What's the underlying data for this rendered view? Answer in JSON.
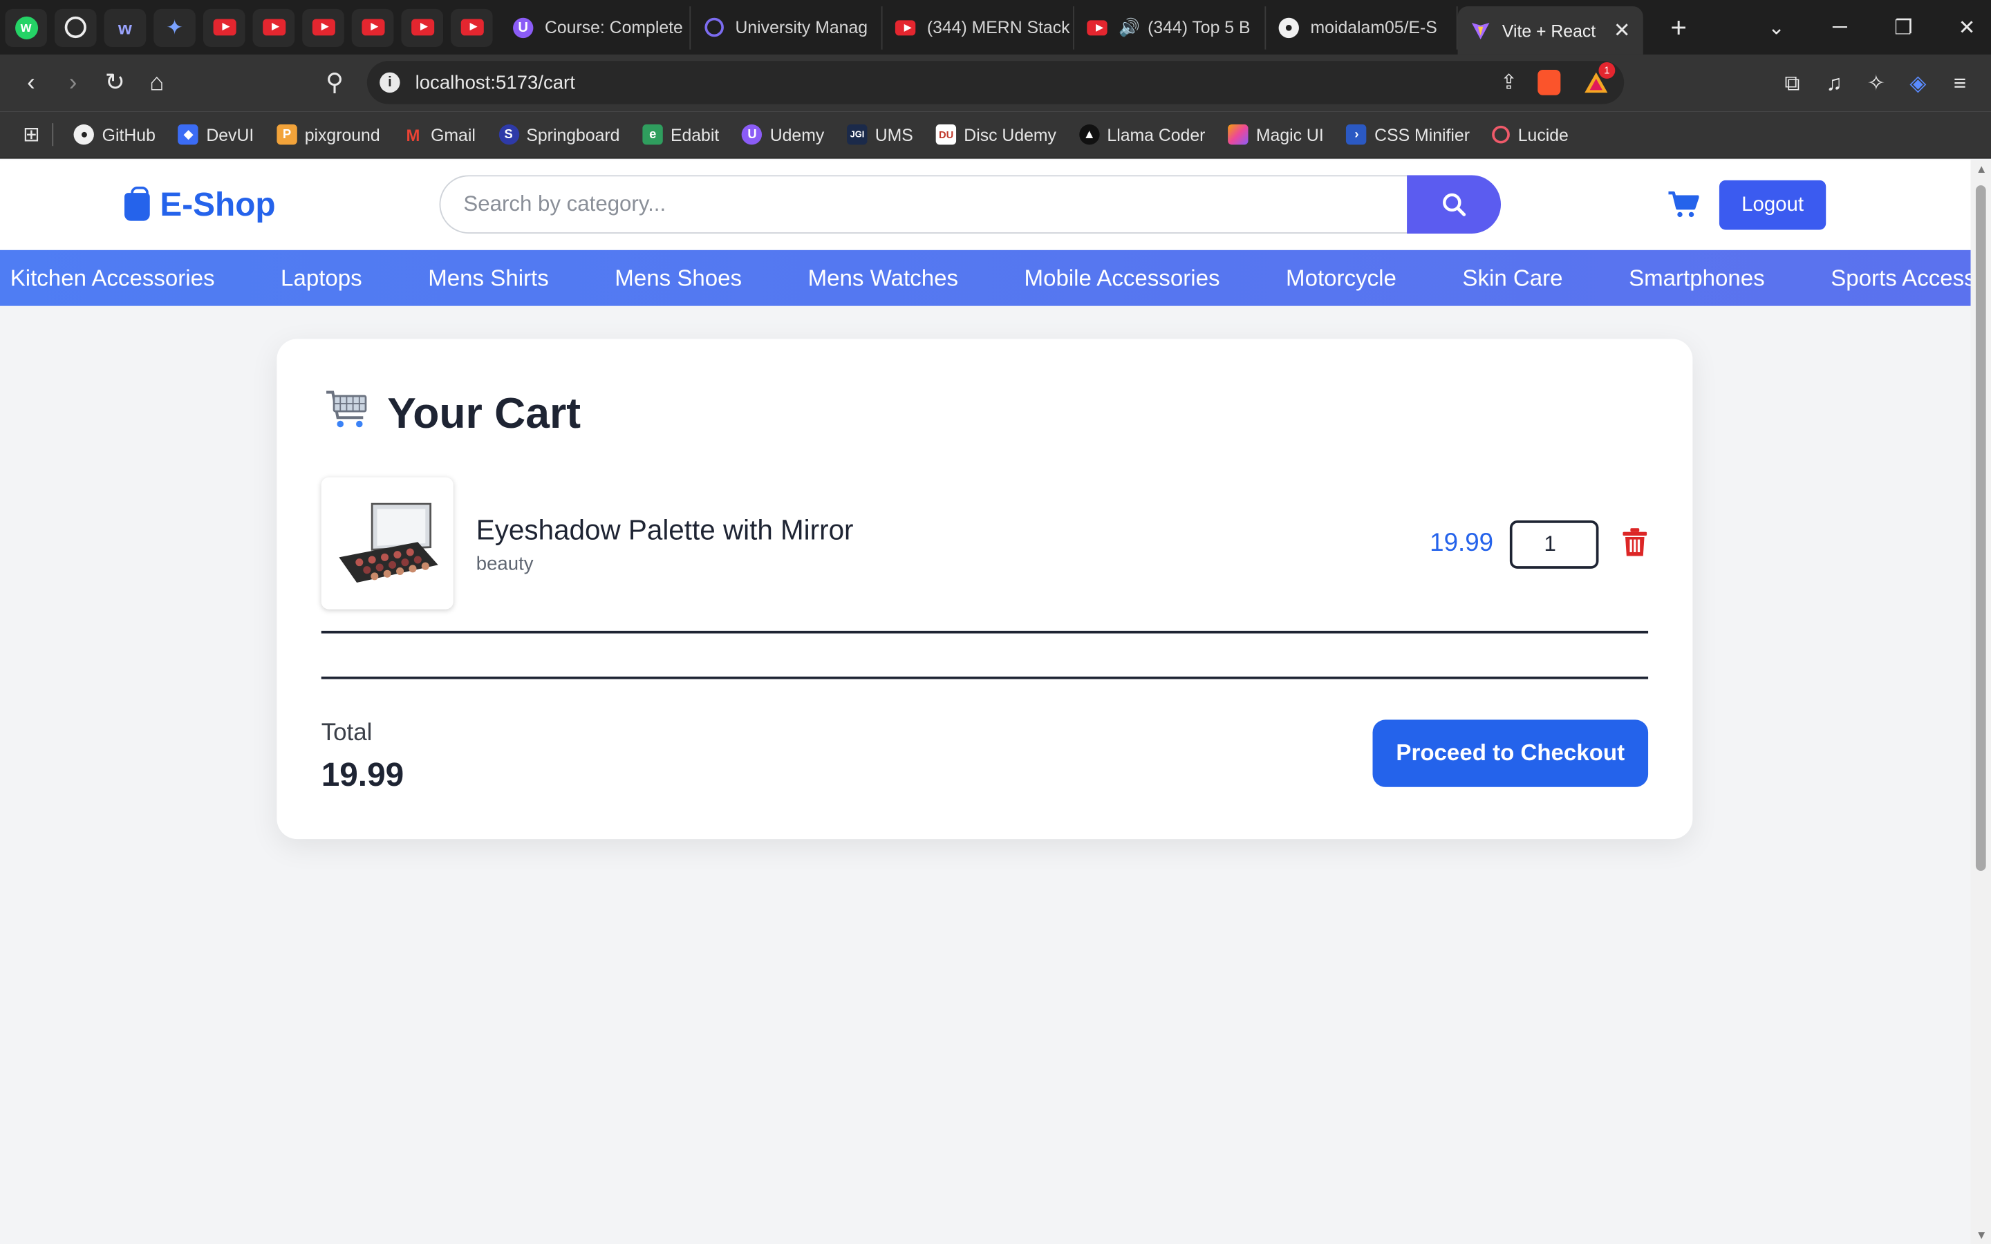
{
  "browser": {
    "tabs": [
      {
        "title": "Course: Complete",
        "icon": "udemy-icon"
      },
      {
        "title": "University Manag",
        "icon": "circle-icon"
      },
      {
        "title": "(344) MERN Stack",
        "icon": "youtube-icon"
      },
      {
        "title": "(344) Top 5 B",
        "icon": "youtube-icon"
      },
      {
        "title": "moidalam05/E-S",
        "icon": "github-icon"
      },
      {
        "title": "Vite + React",
        "icon": "vite-icon"
      }
    ],
    "url": "localhost:5173/cart",
    "notification_count": "1",
    "bookmarks": [
      "GitHub",
      "DevUI",
      "pixground",
      "Gmail",
      "Springboard",
      "Edabit",
      "Udemy",
      "UMS",
      "Disc Udemy",
      "Llama Coder",
      "Magic UI",
      "CSS Minifier",
      "Lucide"
    ]
  },
  "header": {
    "logo": "E-Shop",
    "search_placeholder": "Search by category...",
    "logout_label": "Logout"
  },
  "categories": [
    "Kitchen Accessories",
    "Laptops",
    "Mens Shirts",
    "Mens Shoes",
    "Mens Watches",
    "Mobile Accessories",
    "Motorcycle",
    "Skin Care",
    "Smartphones",
    "Sports Accessories"
  ],
  "cart": {
    "title": "Your Cart",
    "items": [
      {
        "name": "Eyeshadow Palette with Mirror",
        "category": "beauty",
        "price": "19.99",
        "quantity": "1"
      }
    ],
    "total_label": "Total",
    "total_value": "19.99",
    "checkout_label": "Proceed to Checkout"
  },
  "colors": {
    "accent": "#2563eb",
    "search_button": "#5b5cf0",
    "delete": "#dc2626"
  }
}
